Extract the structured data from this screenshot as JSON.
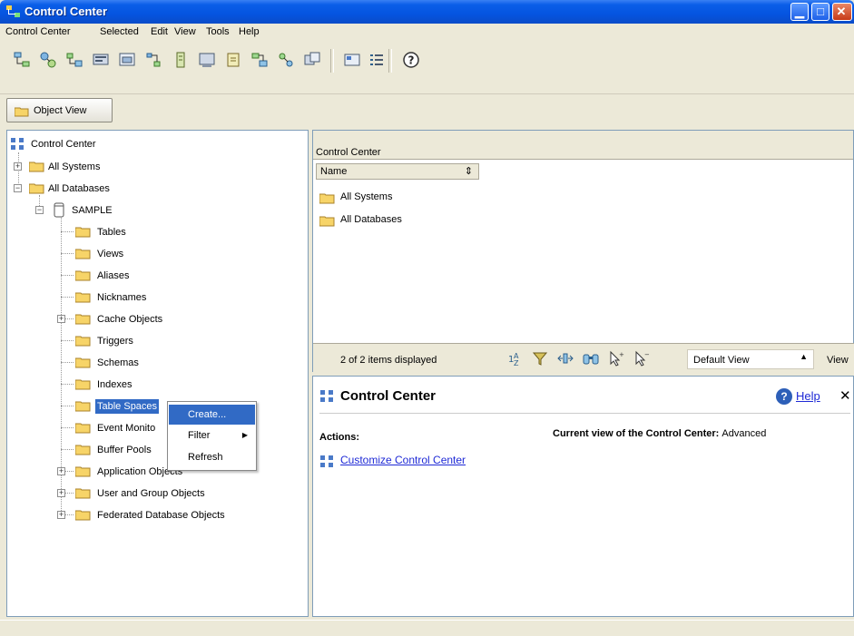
{
  "window": {
    "title": "Control Center"
  },
  "menu": [
    "Control Center",
    "Selected",
    "Edit",
    "View",
    "Tools",
    "Help"
  ],
  "object_view_tab": "Object View",
  "tree": {
    "root": "Control Center",
    "all_systems": "All Systems",
    "all_databases": "All Databases",
    "sample": "SAMPLE",
    "tables": "Tables",
    "views": "Views",
    "aliases": "Aliases",
    "nicknames": "Nicknames",
    "cache_objects": "Cache Objects",
    "triggers": "Triggers",
    "schemas": "Schemas",
    "indexes": "Indexes",
    "table_spaces": "Table Spaces",
    "event_monitors": "Event Monito",
    "buffer_pools": "Buffer Pools",
    "application_objects": "Application Objects",
    "user_group_objects": "User and Group Objects",
    "federated_objects": "Federated Database Objects"
  },
  "context_menu": {
    "create": "Create...",
    "filter": "Filter",
    "refresh": "Refresh"
  },
  "list": {
    "header": "Control Center",
    "column_name": "Name",
    "rows": [
      "All Systems",
      "All Databases"
    ],
    "status": "2 of 2 items displayed",
    "view_select": "Default View",
    "view_label": "View"
  },
  "details": {
    "title": "Control Center",
    "help": "Help",
    "actions_label": "Actions:",
    "current_view_label": "Current view of the Control Center:",
    "current_view_value": "Advanced",
    "customize_link": "Customize Control Center"
  },
  "colors": {
    "title_blue": "#0554e0",
    "folder_yellow": "#f7d468",
    "selection_blue": "#316ac5",
    "link_blue": "#1f2ad6"
  }
}
